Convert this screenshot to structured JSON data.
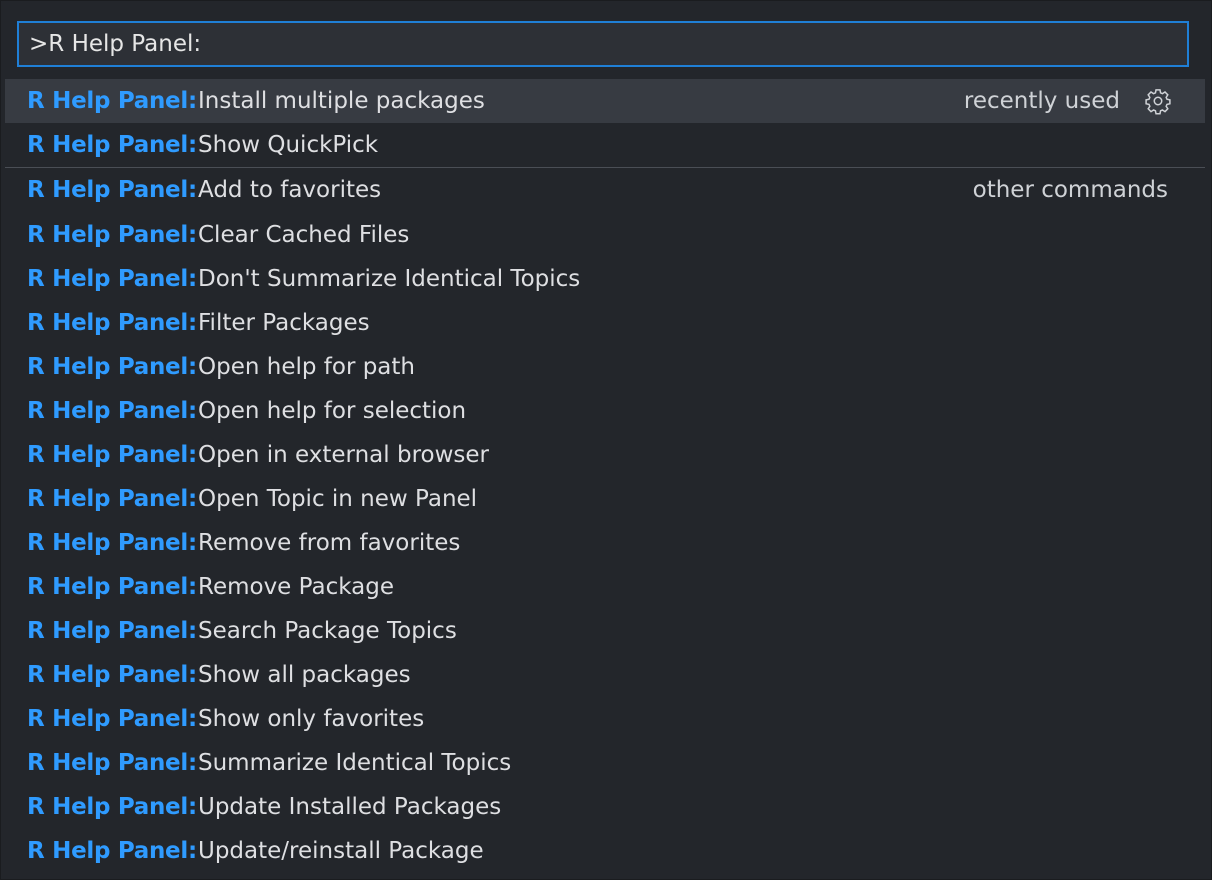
{
  "search": {
    "value": ">R Help Panel:"
  },
  "recent": {
    "label": "recently used",
    "items": [
      {
        "prefix": "R Help Panel:",
        "label": "Install multiple packages"
      },
      {
        "prefix": "R Help Panel:",
        "label": "Show QuickPick"
      }
    ]
  },
  "other": {
    "label": "other commands",
    "items": [
      {
        "prefix": "R Help Panel:",
        "label": "Add to favorites"
      },
      {
        "prefix": "R Help Panel:",
        "label": "Clear Cached Files"
      },
      {
        "prefix": "R Help Panel:",
        "label": "Don't Summarize Identical Topics"
      },
      {
        "prefix": "R Help Panel:",
        "label": "Filter Packages"
      },
      {
        "prefix": "R Help Panel:",
        "label": "Open help for path"
      },
      {
        "prefix": "R Help Panel:",
        "label": "Open help for selection"
      },
      {
        "prefix": "R Help Panel:",
        "label": "Open in external browser"
      },
      {
        "prefix": "R Help Panel:",
        "label": "Open Topic in new Panel"
      },
      {
        "prefix": "R Help Panel:",
        "label": "Remove from favorites"
      },
      {
        "prefix": "R Help Panel:",
        "label": "Remove Package"
      },
      {
        "prefix": "R Help Panel:",
        "label": "Search Package Topics"
      },
      {
        "prefix": "R Help Panel:",
        "label": "Show all packages"
      },
      {
        "prefix": "R Help Panel:",
        "label": "Show only favorites"
      },
      {
        "prefix": "R Help Panel:",
        "label": "Summarize Identical Topics"
      },
      {
        "prefix": "R Help Panel:",
        "label": "Update Installed Packages"
      },
      {
        "prefix": "R Help Panel:",
        "label": "Update/reinstall Package"
      }
    ]
  },
  "icons": {
    "configure": "gear-icon"
  },
  "colors": {
    "accent": "#2f9bff",
    "focus_border": "#1f7fd6",
    "selected_row": "#373b42",
    "background": "#23262b"
  }
}
